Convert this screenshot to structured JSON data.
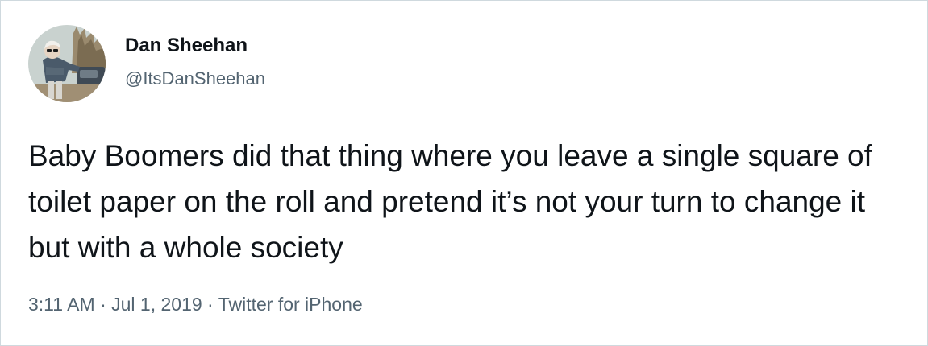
{
  "author": {
    "name": "Dan Sheehan",
    "handle": "@ItsDanSheehan"
  },
  "tweet": {
    "text": "Baby Boomers did that thing where you leave a single square of toilet paper on the roll and pretend it’s not your turn to change it but with a whole society",
    "time": "3:11 AM",
    "date": "Jul 1, 2019",
    "source": "Twitter for iPhone",
    "separator": " · "
  },
  "colors": {
    "text_primary": "#0f1419",
    "text_secondary": "#536471",
    "border": "#cfd9de",
    "background": "#ffffff"
  }
}
